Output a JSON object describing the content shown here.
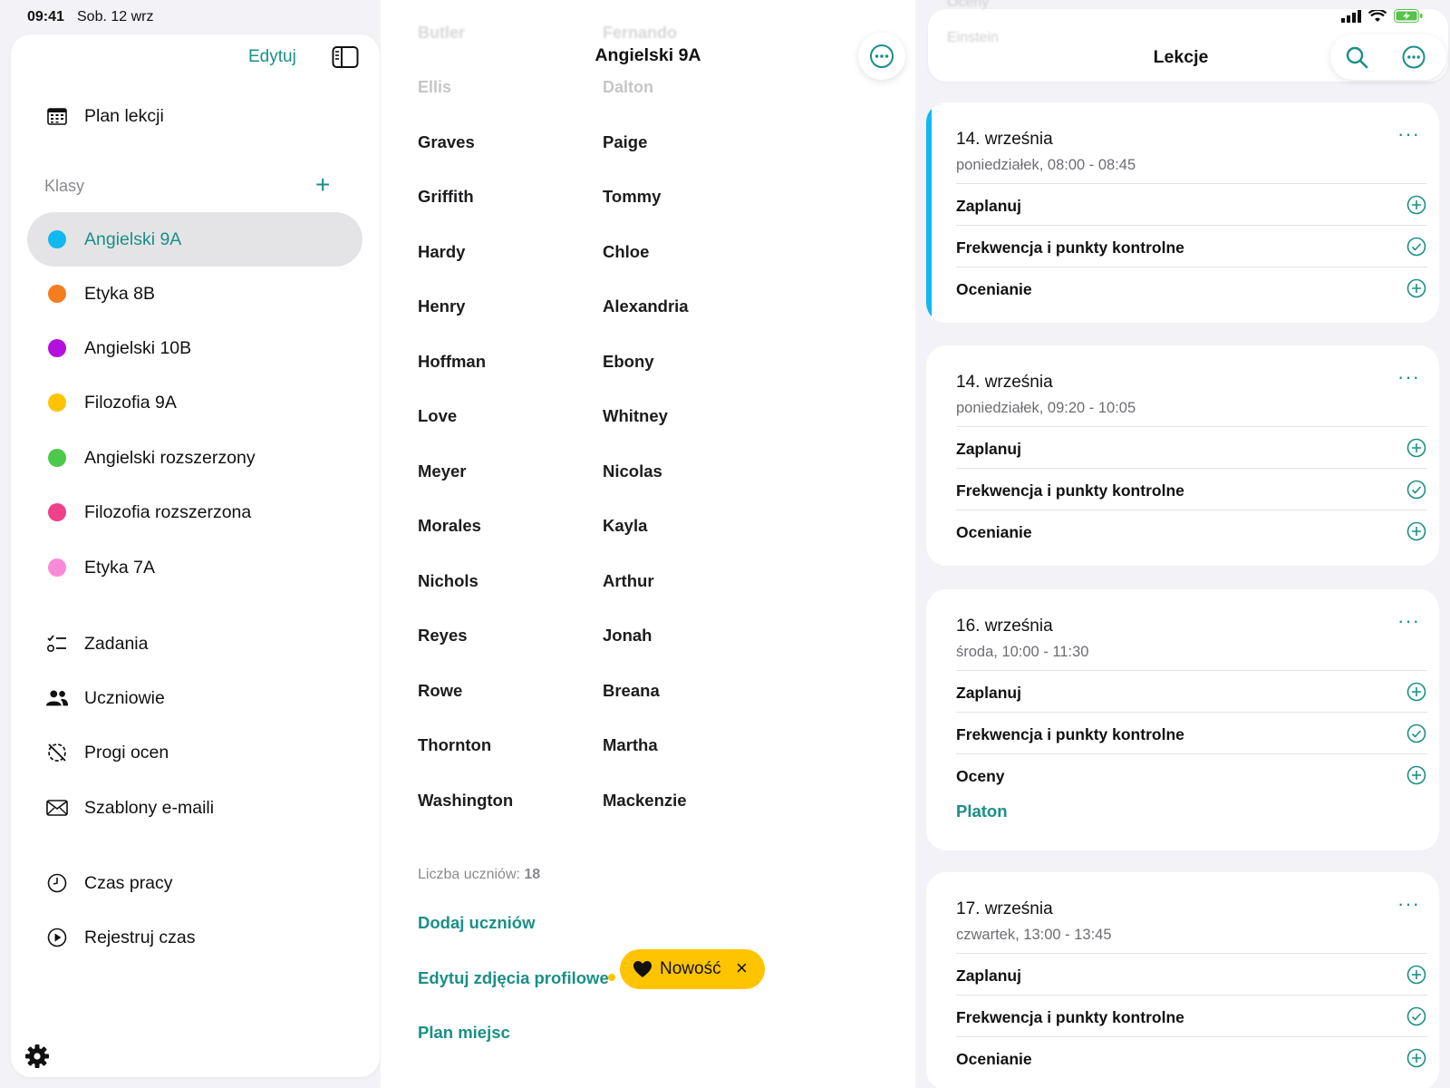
{
  "status": {
    "time": "09:41",
    "date": "Sob. 12 wrz"
  },
  "colors": {
    "accent": "#1a8f86",
    "highlight": "#ffc400",
    "lesson_stripe": "#12b8f0"
  },
  "sidebar": {
    "edit_label": "Edytuj",
    "schedule_label": "Plan lekcji",
    "classes_section": "Klasy",
    "classes": [
      {
        "label": "Angielski 9A",
        "color": "#12b8f0",
        "active": true
      },
      {
        "label": "Etyka 8B",
        "color": "#f57c1f"
      },
      {
        "label": "Angielski 10B",
        "color": "#b50fdd"
      },
      {
        "label": "Filozofia 9A",
        "color": "#ffc400"
      },
      {
        "label": "Angielski rozszerzony",
        "color": "#4cc84a"
      },
      {
        "label": "Filozofia rozszerzona",
        "color": "#f03f8b"
      },
      {
        "label": "Etyka 7A",
        "color": "#f78bd8"
      }
    ],
    "tools": [
      {
        "label": "Zadania",
        "icon": "tasks-icon"
      },
      {
        "label": "Uczniowie",
        "icon": "students-icon"
      },
      {
        "label": "Progi ocen",
        "icon": "grade-threshold-icon"
      },
      {
        "label": "Szablony e-maili",
        "icon": "mail-icon"
      }
    ],
    "time": [
      {
        "label": "Czas pracy",
        "icon": "clock-icon"
      },
      {
        "label": "Rejestruj czas",
        "icon": "play-icon"
      }
    ]
  },
  "middle": {
    "title": "Angielski 9A",
    "faded": [
      {
        "last": "Butler",
        "first": "Fernando"
      },
      {
        "last": "Ellis",
        "first": "Dalton"
      }
    ],
    "students": [
      {
        "last": "Graves",
        "first": "Paige"
      },
      {
        "last": "Griffith",
        "first": "Tommy"
      },
      {
        "last": "Hardy",
        "first": "Chloe"
      },
      {
        "last": "Henry",
        "first": "Alexandria"
      },
      {
        "last": "Hoffman",
        "first": "Ebony"
      },
      {
        "last": "Love",
        "first": "Whitney"
      },
      {
        "last": "Meyer",
        "first": "Nicolas"
      },
      {
        "last": "Morales",
        "first": "Kayla"
      },
      {
        "last": "Nichols",
        "first": "Arthur"
      },
      {
        "last": "Reyes",
        "first": "Jonah"
      },
      {
        "last": "Rowe",
        "first": "Breana"
      },
      {
        "last": "Thornton",
        "first": "Martha"
      },
      {
        "last": "Washington",
        "first": "Mackenzie"
      }
    ],
    "count_label": "Liczba uczniów:",
    "count_value": "18",
    "add_students": "Dodaj uczniów",
    "edit_photos": "Edytuj zdjęcia profilowe",
    "seat_plan": "Plan miejsc",
    "new_badge": "Nowość"
  },
  "right": {
    "title": "Lekcje",
    "faded": [
      "Oceny",
      "Einstein"
    ],
    "lessons": [
      {
        "date": "14. września",
        "time": "poniedziałek, 08:00 - 08:45",
        "rows": [
          {
            "label": "Zaplanuj",
            "icon": "plus-circle-icon"
          },
          {
            "label": "Frekwencja i punkty kontrolne",
            "icon": "check-circle-icon"
          },
          {
            "label": "Ocenianie",
            "icon": "plus-circle-icon"
          }
        ]
      },
      {
        "date": "14. września",
        "time": "poniedziałek, 09:20 - 10:05",
        "rows": [
          {
            "label": "Zaplanuj",
            "icon": "plus-circle-icon"
          },
          {
            "label": "Frekwencja i punkty kontrolne",
            "icon": "check-circle-icon"
          },
          {
            "label": "Ocenianie",
            "icon": "plus-circle-icon"
          }
        ]
      },
      {
        "date": "16. września",
        "time": "środa, 10:00 - 11:30",
        "rows": [
          {
            "label": "Zaplanuj",
            "icon": "plus-circle-icon"
          },
          {
            "label": "Frekwencja i punkty kontrolne",
            "icon": "check-circle-icon"
          },
          {
            "label": "Oceny",
            "icon": "plus-circle-icon"
          }
        ],
        "extra": "Platon"
      },
      {
        "date": "17. września",
        "time": "czwartek, 13:00 - 13:45",
        "rows": [
          {
            "label": "Zaplanuj",
            "icon": "plus-circle-icon"
          },
          {
            "label": "Frekwencja i punkty kontrolne",
            "icon": "check-circle-icon"
          },
          {
            "label": "Ocenianie",
            "icon": "plus-circle-icon"
          }
        ]
      }
    ]
  }
}
